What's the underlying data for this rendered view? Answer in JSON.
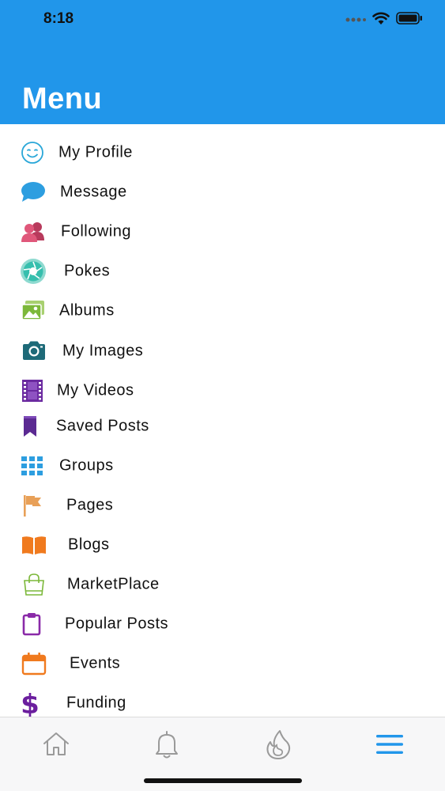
{
  "status_bar": {
    "time": "8:18"
  },
  "header": {
    "title": "Menu",
    "background": "#2196ea"
  },
  "menu": {
    "items": [
      {
        "label": "My Profile",
        "icon": "smiley-icon",
        "color": "#2aa7d8"
      },
      {
        "label": "Message",
        "icon": "chat-bubble-icon",
        "color": "#2d9ee0"
      },
      {
        "label": "Following",
        "icon": "users-icon",
        "color": "#d0496b"
      },
      {
        "label": "Pokes",
        "icon": "aperture-icon",
        "color": "#36bfae"
      },
      {
        "label": "Albums",
        "icon": "photo-album-icon",
        "color": "#7cb83a"
      },
      {
        "label": "My Images",
        "icon": "camera-icon",
        "color": "#1e6a78"
      },
      {
        "label": "My Videos",
        "icon": "film-icon",
        "color": "#6b2aa0"
      },
      {
        "label": "Saved Posts",
        "icon": "bookmark-icon",
        "color": "#5b2a92"
      },
      {
        "label": "Groups",
        "icon": "grid-icon",
        "color": "#2d9ee0"
      },
      {
        "label": "Pages",
        "icon": "flag-icon",
        "color": "#e8a058"
      },
      {
        "label": "Blogs",
        "icon": "book-icon",
        "color": "#f07a1e"
      },
      {
        "label": "MarketPlace",
        "icon": "shopping-bag-icon",
        "color": "#7cb83a"
      },
      {
        "label": "Popular Posts",
        "icon": "clipboard-icon",
        "color": "#8a2aa8"
      },
      {
        "label": "Events",
        "icon": "calendar-icon",
        "color": "#f07a1e"
      },
      {
        "label": "Funding",
        "icon": "dollar-icon",
        "color": "#6b1e9e"
      }
    ]
  },
  "tabbar": {
    "tabs": [
      {
        "name": "home",
        "icon": "home-icon",
        "active": false
      },
      {
        "name": "notifications",
        "icon": "bell-icon",
        "active": false
      },
      {
        "name": "trending",
        "icon": "flame-icon",
        "active": false
      },
      {
        "name": "menu",
        "icon": "hamburger-icon",
        "active": true
      }
    ],
    "active_color": "#2196ea",
    "inactive_color": "#9a9a9a"
  }
}
